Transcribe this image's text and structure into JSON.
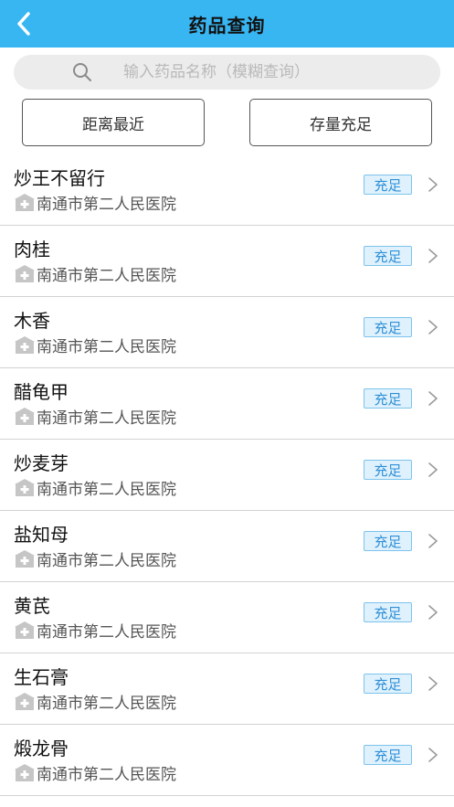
{
  "header": {
    "title": "药品查询"
  },
  "search": {
    "placeholder": "输入药品名称（模糊查询）"
  },
  "filters": {
    "distance_label": "距离最近",
    "stock_label": "存量充足"
  },
  "colors": {
    "header_bg": "#38b6f2",
    "badge_bg": "#dff1fd",
    "badge_text": "#2e8fd6"
  },
  "items": [
    {
      "name": "炒王不留行",
      "hospital": "南通市第二人民医院",
      "stock": "充足"
    },
    {
      "name": "肉桂",
      "hospital": "南通市第二人民医院",
      "stock": "充足"
    },
    {
      "name": "木香",
      "hospital": "南通市第二人民医院",
      "stock": "充足"
    },
    {
      "name": "醋龟甲",
      "hospital": "南通市第二人民医院",
      "stock": "充足"
    },
    {
      "name": "炒麦芽",
      "hospital": "南通市第二人民医院",
      "stock": "充足"
    },
    {
      "name": "盐知母",
      "hospital": "南通市第二人民医院",
      "stock": "充足"
    },
    {
      "name": "黄芪",
      "hospital": "南通市第二人民医院",
      "stock": "充足"
    },
    {
      "name": "生石膏",
      "hospital": "南通市第二人民医院",
      "stock": "充足"
    },
    {
      "name": "煅龙骨",
      "hospital": "南通市第二人民医院",
      "stock": "充足"
    }
  ]
}
